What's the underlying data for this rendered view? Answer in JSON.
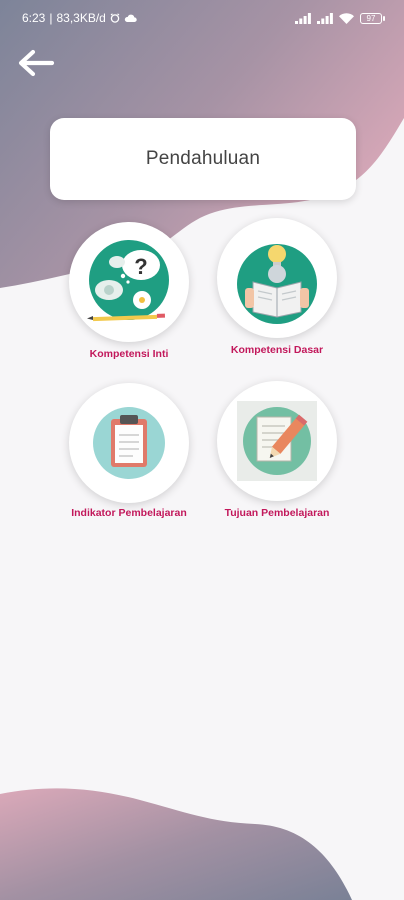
{
  "status_bar": {
    "time": "6:23",
    "network_speed": "83,3KB/d",
    "battery_level": "97",
    "icons": [
      "alarm-icon",
      "cloud-icon",
      "signal-icon",
      "signal-icon",
      "wifi-icon",
      "battery-icon"
    ]
  },
  "header": {
    "back_icon": "arrow-left-icon",
    "title": "Pendahuluan"
  },
  "menu": {
    "items": [
      {
        "label": "Kompetensi Inti",
        "icon": "question-thought-icon"
      },
      {
        "label": "Kompetensi Dasar",
        "icon": "reading-idea-icon"
      },
      {
        "label": "Indikator Pembelajaran",
        "icon": "clipboard-icon"
      },
      {
        "label": "Tujuan Pembelajaran",
        "icon": "document-pencil-icon"
      }
    ]
  },
  "colors": {
    "label_pink": "#c2185b",
    "icon_teal": "#1f9e82",
    "icon_light_teal": "#9ad6d4",
    "icon_mint": "#73bfa3",
    "gradient_slate": "#7c8499",
    "gradient_pink": "#d9a7b8",
    "background": "#f7f6f8"
  }
}
